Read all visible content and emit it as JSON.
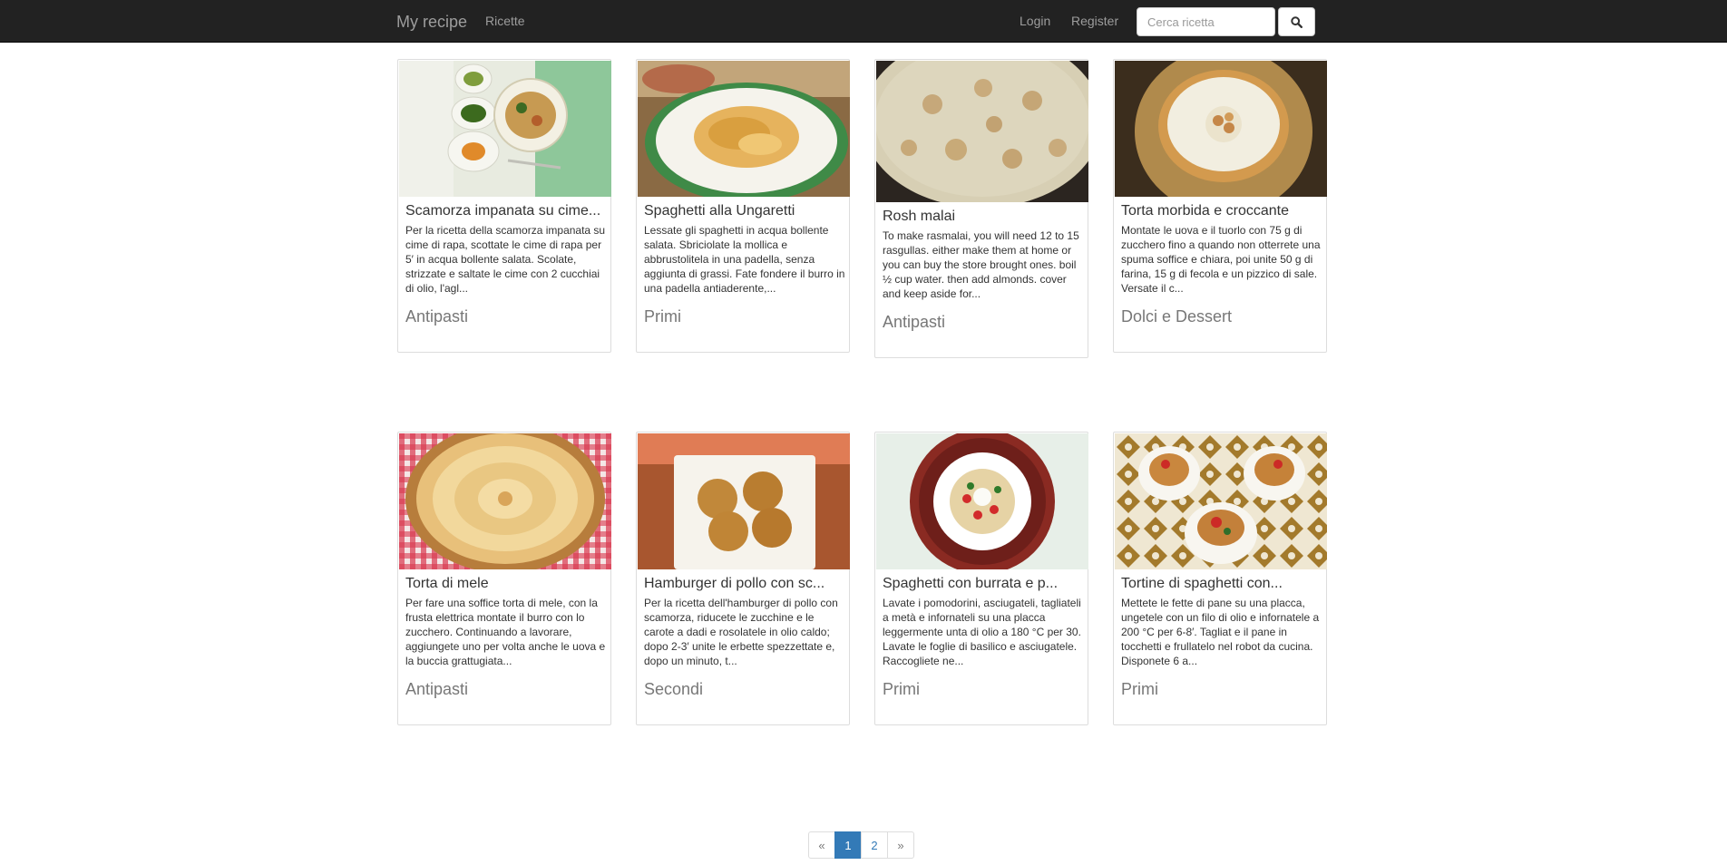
{
  "navbar": {
    "brand": "My recipe",
    "recipes_link": "Ricette",
    "login": "Login",
    "register": "Register",
    "search_placeholder": "Cerca ricetta",
    "search_icon": "search-icon"
  },
  "recipes": [
    {
      "title": "Scamorza impanata su cime...",
      "text": "Per la ricetta della scamorza impanata su cime di rapa, scottate le cime di rapa per 5′ in acqua bollente salata. Scolate, strizzate e saltate le cime con 2 cucchiai di olio, l'agl...",
      "category": "Antipasti",
      "image": "plated-scamorza-photo"
    },
    {
      "title": "Spaghetti alla Ungaretti",
      "text": "Lessate gli spaghetti in acqua bollente salata. Sbriciolate la mollica e abbrustolitela in una padella, senza aggiunta di grassi. Fate fondere il burro in una padella antiaderente,...",
      "category": "Primi",
      "image": "spaghetti-plate-photo"
    },
    {
      "title": "Rosh malai",
      "text": "To make rasmalai, you will need 12 to 15 rasgullas. either make them at home or you can buy the store brought ones. boil ½ cup water. then add almonds. cover and keep aside for...",
      "category": "Antipasti",
      "image": "rasmalai-pan-photo"
    },
    {
      "title": "Torta morbida e croccante",
      "text": "Montate le uova e il tuorlo con 75 g di zucchero fino a quando non otterrete una spuma soffice e chiara, poi unite 50 g di farina, 15 g di fecola e un pizzico di sale. Versate il c...",
      "category": "Dolci e Dessert",
      "image": "cake-on-gold-plate-photo"
    },
    {
      "title": "Torta di mele",
      "text": "Per fare una soffice torta di mele, con la frusta elettrica montate il burro con lo zucchero. Continuando a lavorare, aggiungete uno per volta anche le uova e la buccia grattugiata...",
      "category": "Antipasti",
      "image": "apple-tart-photo"
    },
    {
      "title": "Hamburger di pollo con sc...",
      "text": "Per la ricetta dell'hamburger di pollo con scamorza, riducete le zucchine e le carote a dadi e rosolatele in olio caldo; dopo 2-3′ unite le erbette spezzettate e, dopo un minuto, t...",
      "category": "Secondi",
      "image": "chicken-burgers-photo"
    },
    {
      "title": "Spaghetti con burrata e p...",
      "text": "Lavate i pomodorini, asciugateli, tagliateli a metà e infornateli su una placca leggermente unta di olio a 180 °C per 30. Lavate le foglie di basilico e asciugatele. Raccogliete ne...",
      "category": "Primi",
      "image": "spaghetti-burrata-photo"
    },
    {
      "title": "Tortine di spaghetti con...",
      "text": "Mettete le fette di pane su una placca, ungetele con un filo di olio e infornatele a 200 °C per 6-8′. Tagliat e il pane in tocchetti e frullatelo nel robot da cucina. Disponete 6 a...",
      "category": "Primi",
      "image": "spaghetti-tartlets-photo"
    }
  ],
  "pagination": {
    "prev": "«",
    "pages": [
      "1",
      "2"
    ],
    "active_page": "1",
    "next": "»"
  }
}
